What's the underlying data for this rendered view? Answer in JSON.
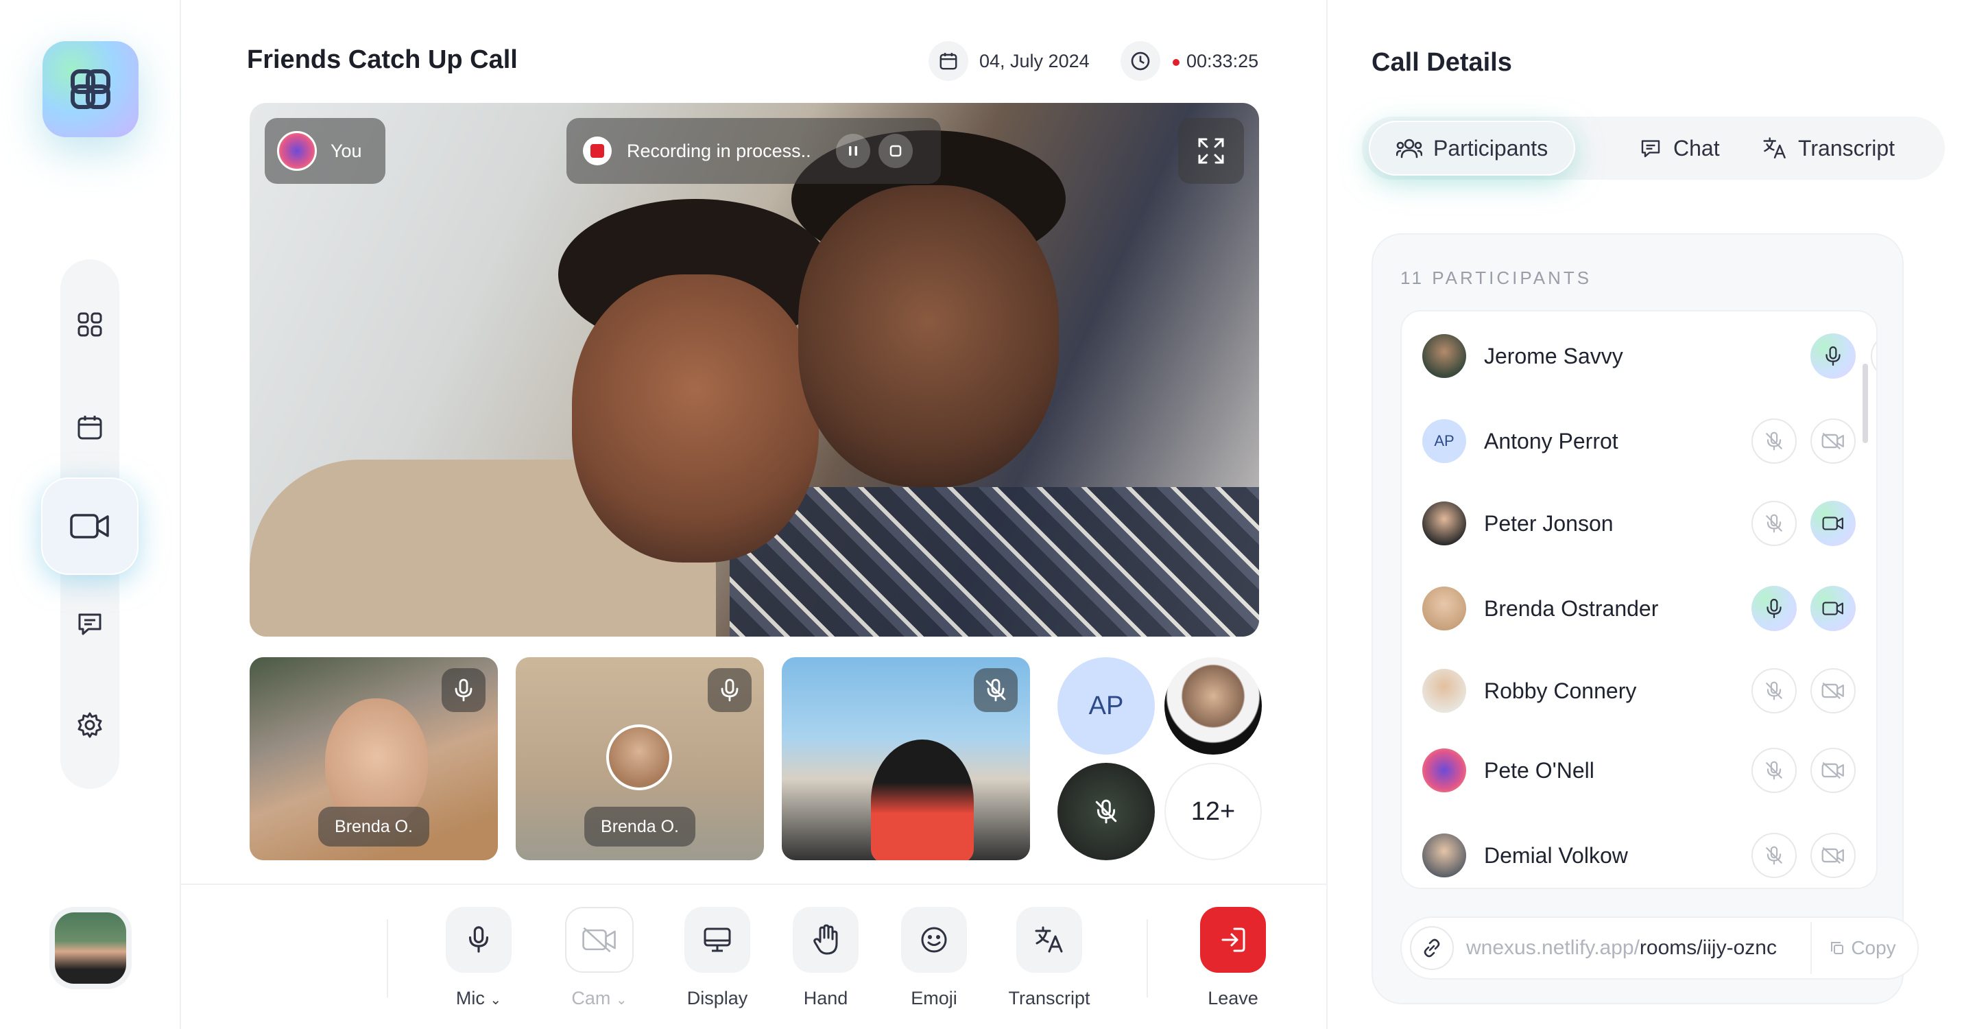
{
  "sidebar": {
    "items": [
      {
        "icon": "grid-icon"
      },
      {
        "icon": "calendar-icon"
      },
      {
        "icon": "video-icon",
        "active": true
      },
      {
        "icon": "chat-icon"
      },
      {
        "icon": "settings-icon"
      }
    ]
  },
  "call": {
    "title": "Friends Catch Up Call",
    "date": "04, July 2024",
    "duration": "00:33:25",
    "recording_color": "#e0202a"
  },
  "stage": {
    "self_label": "You",
    "recording_text": "Recording in process.."
  },
  "tiles": [
    {
      "name": "Brenda O.",
      "mic": "on"
    },
    {
      "name": "Brenda O.",
      "mic": "on"
    },
    {
      "name": "",
      "mic": "muted"
    }
  ],
  "mini": {
    "initials": "AP",
    "more": "12+"
  },
  "toolbar": {
    "mic": "Mic",
    "cam": "Cam",
    "display": "Display",
    "hand": "Hand",
    "emoji": "Emoji",
    "transcript": "Transcript",
    "leave": "Leave",
    "leave_color": "#e5262d"
  },
  "panel": {
    "title": "Call Details",
    "tabs": {
      "participants": "Participants",
      "chat": "Chat",
      "transcript": "Transcript"
    },
    "count_label": "11 PARTICIPANTS",
    "participants": [
      {
        "name": "Jerome Savvy",
        "initials": "",
        "mic": "on",
        "cam": "off"
      },
      {
        "name": "Antony Perrot",
        "initials": "AP",
        "mic": "off",
        "cam": "off"
      },
      {
        "name": "Peter Jonson",
        "initials": "",
        "mic": "off",
        "cam": "on"
      },
      {
        "name": "Brenda Ostrander",
        "initials": "",
        "mic": "on",
        "cam": "on"
      },
      {
        "name": "Robby Connery",
        "initials": "",
        "mic": "off",
        "cam": "off"
      },
      {
        "name": "Pete O'Nell",
        "initials": "",
        "mic": "off",
        "cam": "off"
      },
      {
        "name": "Demial Volkow",
        "initials": "",
        "mic": "off",
        "cam": "off"
      }
    ],
    "link": {
      "host": "wnexus.netlify.app/",
      "path": "rooms/iijy-oznc",
      "copy": "Copy"
    }
  }
}
